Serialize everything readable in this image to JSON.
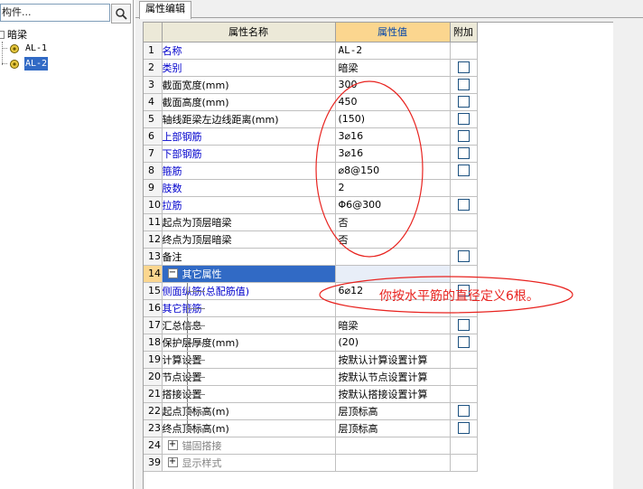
{
  "left_panel": {
    "search_text": "构件...",
    "tree": {
      "root": "暗梁",
      "items": [
        "AL-1",
        "AL-2"
      ],
      "selected": "AL-2"
    }
  },
  "tab": {
    "label": "属性编辑"
  },
  "table": {
    "headers": {
      "name": "属性名称",
      "value": "属性值",
      "extra": "附加"
    },
    "rows": [
      {
        "no": "1",
        "name": "名称",
        "value": "AL-2",
        "color": "blue"
      },
      {
        "no": "2",
        "name": "类别",
        "value": "暗梁",
        "color": "blue"
      },
      {
        "no": "3",
        "name": "截面宽度(mm)",
        "value": "300"
      },
      {
        "no": "4",
        "name": "截面高度(mm)",
        "value": "450"
      },
      {
        "no": "5",
        "name": "轴线距梁左边线距离(mm)",
        "value": "(150)"
      },
      {
        "no": "6",
        "name": "上部钢筋",
        "value": "3⌀16",
        "color": "blue"
      },
      {
        "no": "7",
        "name": "下部钢筋",
        "value": "3⌀16",
        "color": "blue"
      },
      {
        "no": "8",
        "name": "箍筋",
        "value": "⌀8@150",
        "color": "blue"
      },
      {
        "no": "9",
        "name": "肢数",
        "value": "2",
        "color": "blue"
      },
      {
        "no": "10",
        "name": "拉筋",
        "value": "Φ6@300",
        "color": "blue"
      },
      {
        "no": "11",
        "name": "起点为顶层暗梁",
        "value": "否"
      },
      {
        "no": "12",
        "name": "终点为顶层暗梁",
        "value": "否"
      },
      {
        "no": "13",
        "name": "备注",
        "value": ""
      },
      {
        "no": "14",
        "name": "其它属性",
        "value": ""
      },
      {
        "no": "15",
        "name": "侧面纵筋(总配筋值)",
        "value": "6⌀12",
        "color": "blue"
      },
      {
        "no": "16",
        "name": "其它箍筋",
        "value": "",
        "color": "blue"
      },
      {
        "no": "17",
        "name": "汇总信息",
        "value": "暗梁"
      },
      {
        "no": "18",
        "name": "保护层厚度(mm)",
        "value": "(20)"
      },
      {
        "no": "19",
        "name": "计算设置",
        "value": "按默认计算设置计算"
      },
      {
        "no": "20",
        "name": "节点设置",
        "value": "按默认节点设置计算"
      },
      {
        "no": "21",
        "name": "搭接设置",
        "value": "按默认搭接设置计算"
      },
      {
        "no": "22",
        "name": "起点顶标高(m)",
        "value": "层顶标高"
      },
      {
        "no": "23",
        "name": "终点顶标高(m)",
        "value": "层顶标高"
      },
      {
        "no": "24",
        "name": "锚固搭接",
        "value": ""
      },
      {
        "no": "39",
        "name": "显示样式",
        "value": ""
      }
    ]
  },
  "annotation": {
    "text": "你按水平筋的直径定义6根。",
    "color": "#e8231f"
  }
}
